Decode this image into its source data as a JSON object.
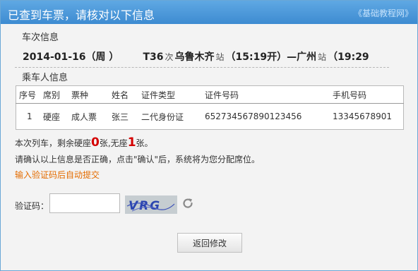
{
  "dialog": {
    "title": "已查到车票，请核对以下信息",
    "tutorial_link": "《基础教程网》"
  },
  "train_section": {
    "label": "车次信息",
    "date": "2014-01-16（周 ）",
    "train_no": "T36",
    "train_suffix": "次",
    "from_station": "乌鲁木齐",
    "from_suffix": "站",
    "depart_time": "（15:19开）",
    "arrow": "—",
    "to_station": "广州",
    "to_suffix": "站",
    "arrive_time": "（19:29"
  },
  "passenger_section": {
    "label": "乘车人信息",
    "headers": [
      "序号",
      "席别",
      "票种",
      "姓名",
      "证件类型",
      "证件号码",
      "手机号码"
    ],
    "rows": [
      [
        "1",
        "硬座",
        "成人票",
        "张三",
        "二代身份证",
        "652734567890123456",
        "13345678901"
      ]
    ]
  },
  "remaining": {
    "prefix": "本次列车，剩余硬座",
    "hard_seat": "0",
    "middle": "张,无座",
    "no_seat": "1",
    "suffix": "张。"
  },
  "confirm_text": "请确认以上信息是否正确，点击\"确认\"后，系统将为您分配席位。",
  "auto_submit_text": "输入验证码后自动提交",
  "captcha": {
    "label": "验证码：",
    "value": "",
    "image_text": "VRG"
  },
  "buttons": {
    "back": "返回修改"
  },
  "colors": {
    "titlebar": "#4a97da",
    "remaining_number": "#d40000",
    "auto_submit_link": "#e46c00"
  }
}
